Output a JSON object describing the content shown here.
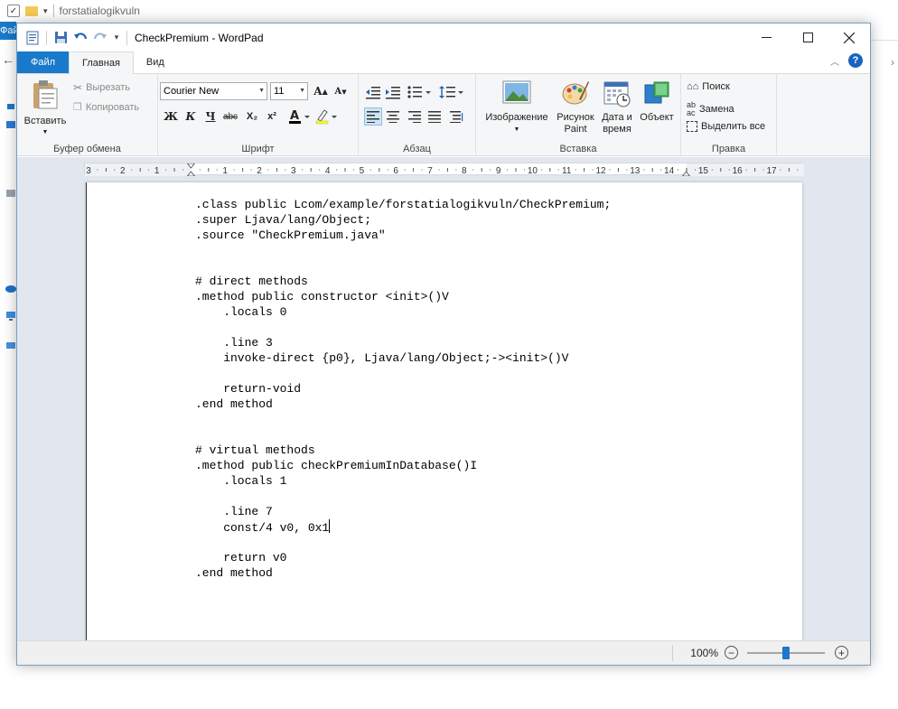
{
  "background": {
    "folder_title": "forstatialogikvuln",
    "file_tab_label": "Фай"
  },
  "window": {
    "title": "CheckPremium - WordPad",
    "controls": {
      "minimize_icon": "minimize-icon",
      "maximize_icon": "maximize-icon",
      "close_icon": "close-icon"
    }
  },
  "ribbon": {
    "tabs": [
      {
        "label": "Файл"
      },
      {
        "label": "Главная"
      },
      {
        "label": "Вид"
      }
    ],
    "clipboard": {
      "group_label": "Буфер обмена",
      "paste_label": "Вставить",
      "cut_label": "Вырезать",
      "copy_label": "Копировать"
    },
    "font": {
      "group_label": "Шрифт",
      "font_name": "Courier New",
      "font_size": "11",
      "bold": "Ж",
      "italic": "К",
      "underline": "Ч",
      "strikethrough": "abc",
      "subscript": "X₂",
      "superscript": "x²"
    },
    "paragraph": {
      "group_label": "Абзац",
      "alignment": "left"
    },
    "insert": {
      "group_label": "Вставка",
      "picture_label": "Изображение",
      "paint_label_1": "Рисунок",
      "paint_label_2": "Paint",
      "datetime_label_1": "Дата и",
      "datetime_label_2": "время",
      "object_label": "Объект"
    },
    "editing": {
      "group_label": "Правка",
      "find_label": "Поиск",
      "replace_label": "Замена",
      "select_all_label": "Выделить все"
    }
  },
  "ruler": {
    "labels": [
      "3",
      "2",
      "1",
      "1",
      "2",
      "3",
      "4",
      "5",
      "6",
      "7",
      "8",
      "9",
      "10",
      "11",
      "12",
      "13",
      "14",
      "15",
      "16",
      "17"
    ]
  },
  "document": {
    "lines": [
      ".class public Lcom/example/forstatialogikvuln/CheckPremium;",
      ".super Ljava/lang/Object;",
      ".source \"CheckPremium.java\"",
      "",
      "",
      "# direct methods",
      ".method public constructor <init>()V",
      "    .locals 0",
      "",
      "    .line 3",
      "    invoke-direct {p0}, Ljava/lang/Object;-><init>()V",
      "",
      "    return-void",
      ".end method",
      "",
      "",
      "# virtual methods",
      ".method public checkPremiumInDatabase()I",
      "    .locals 1",
      "",
      "    .line 7",
      "    const/4 v0, 0x1",
      "",
      "    return v0",
      ".end method"
    ],
    "caret_line": 21
  },
  "statusbar": {
    "zoom_label": "100%",
    "zoom_fraction": 0.5
  },
  "colors": {
    "accent": "#1979ca",
    "doc_background": "#e2e7ef",
    "ribbon_background": "#f5f6f7"
  }
}
